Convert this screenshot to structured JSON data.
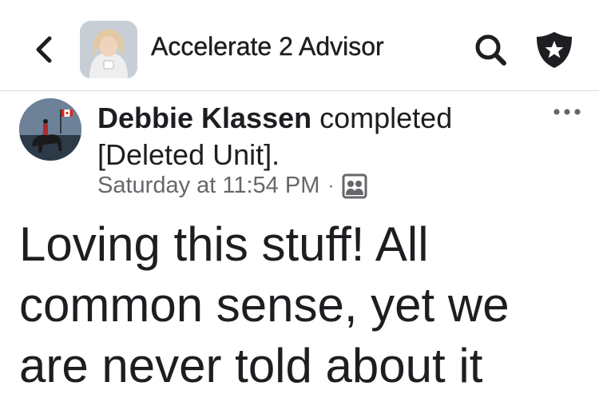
{
  "header": {
    "group_title": "Accelerate 2 Advisor"
  },
  "post": {
    "author": "Debbie Klassen",
    "action": "completed",
    "unit": "[Deleted Unit].",
    "timestamp": "Saturday at 11:54 PM",
    "separator": "·",
    "body": "Loving this stuff! All common sense, yet we are never told about it"
  },
  "colors": {
    "text_primary": "#1c1e21",
    "text_secondary": "#65676b",
    "divider": "#dadde1"
  },
  "icons": {
    "back": "chevron-left-icon",
    "search": "search-icon",
    "shield": "shield-star-icon",
    "more": "more-horizontal-icon",
    "audience": "group-members-icon"
  }
}
